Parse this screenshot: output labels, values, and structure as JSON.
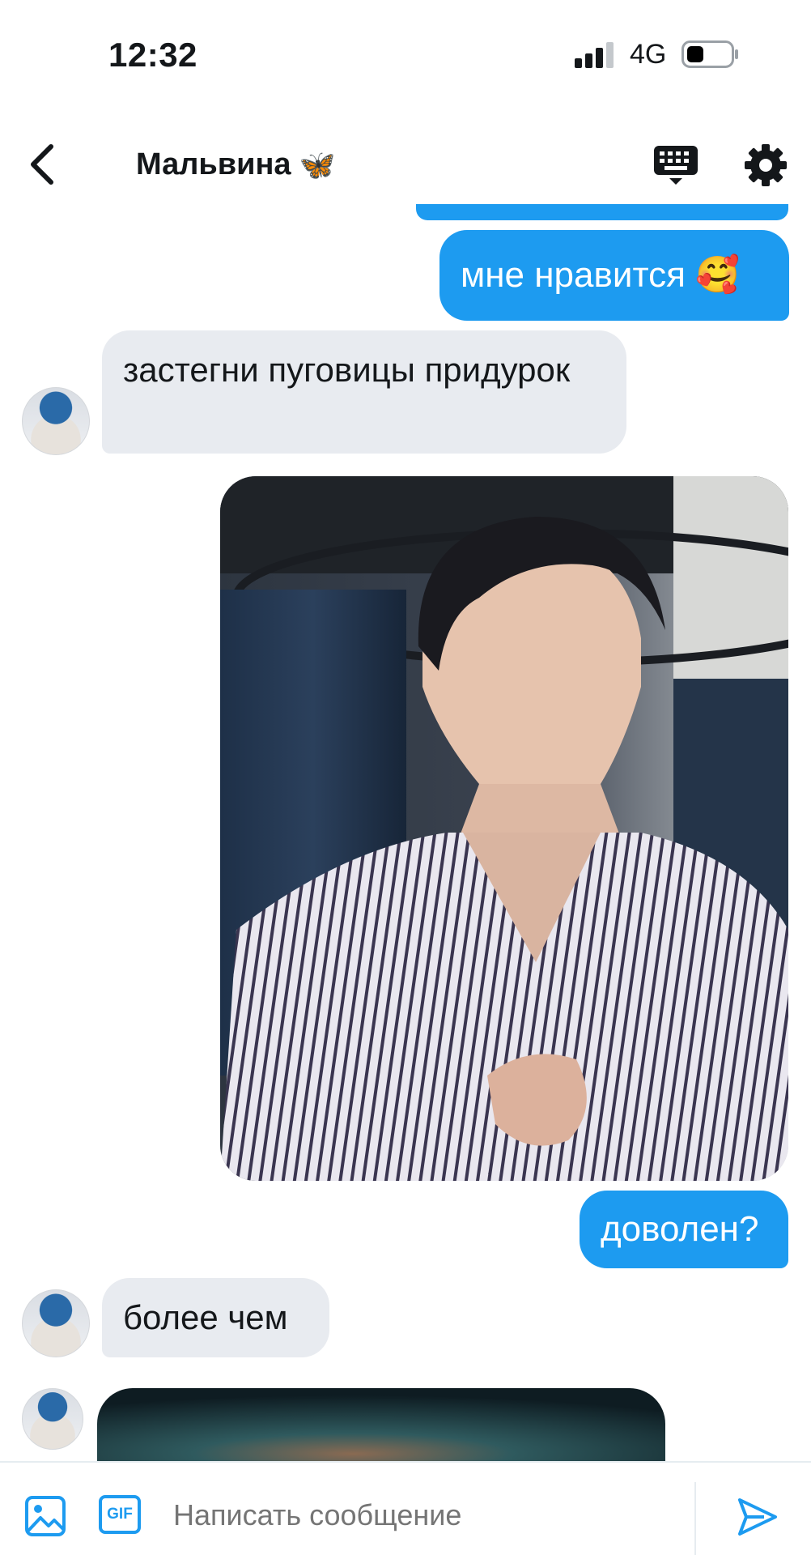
{
  "status_bar": {
    "time": "12:32",
    "network": "4G"
  },
  "header": {
    "title": "Мальвина",
    "title_emoji": "🦋"
  },
  "messages": [
    {
      "from": "me",
      "text": "мне нравится 🥰"
    },
    {
      "from": "them",
      "text": "застегни пуговицы придурок"
    },
    {
      "from": "me",
      "type": "photo"
    },
    {
      "from": "me",
      "text": "доволен?"
    },
    {
      "from": "them",
      "text": "более чем"
    },
    {
      "from": "them",
      "type": "photo"
    }
  ],
  "composer": {
    "placeholder": "Написать сообщение",
    "gif_label": "GIF"
  },
  "colors": {
    "accent": "#1d9bf0",
    "incoming_bubble": "#e8ebf0"
  }
}
